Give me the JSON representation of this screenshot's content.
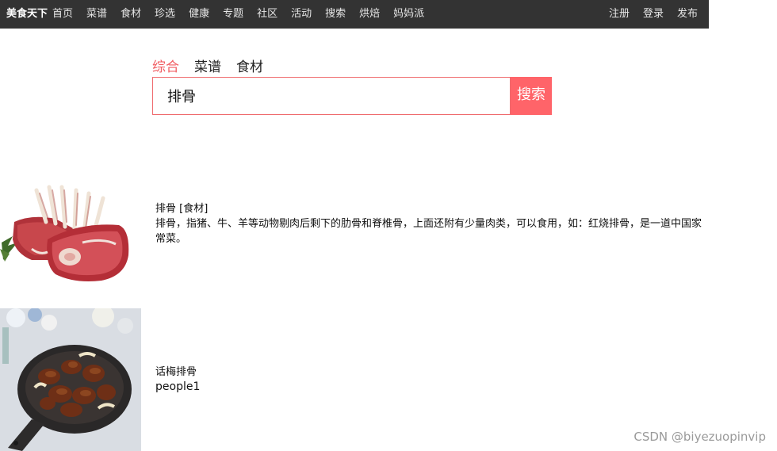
{
  "topbar": {
    "brand": "美食天下",
    "nav_left": [
      "首页",
      "菜谱",
      "食材",
      "珍选",
      "健康",
      "专题",
      "社区",
      "活动",
      "搜索",
      "烘焙",
      "妈妈派"
    ],
    "nav_right": [
      "注册",
      "登录",
      "发布"
    ]
  },
  "search": {
    "tabs": [
      "综合",
      "菜谱",
      "食材"
    ],
    "active_tab": "综合",
    "query": "排骨",
    "button_label": "搜索"
  },
  "results": [
    {
      "title": "排骨 [食材]",
      "description": "排骨，指猪、牛、羊等动物剔肉后剩下的肋骨和脊椎骨，上面还附有少量肉类，可以食用，如：红烧排骨，是一道中国家常菜。",
      "image": "raw-ribs-photo"
    },
    {
      "title": "话梅排骨",
      "author": "people1",
      "image": "braised-plum-ribs-photo"
    }
  ],
  "watermark": "CSDN @biyezuopinvip",
  "colors": {
    "topbar_bg": "#333333",
    "accent": "#ff6469",
    "active_tab": "#f15e63"
  }
}
